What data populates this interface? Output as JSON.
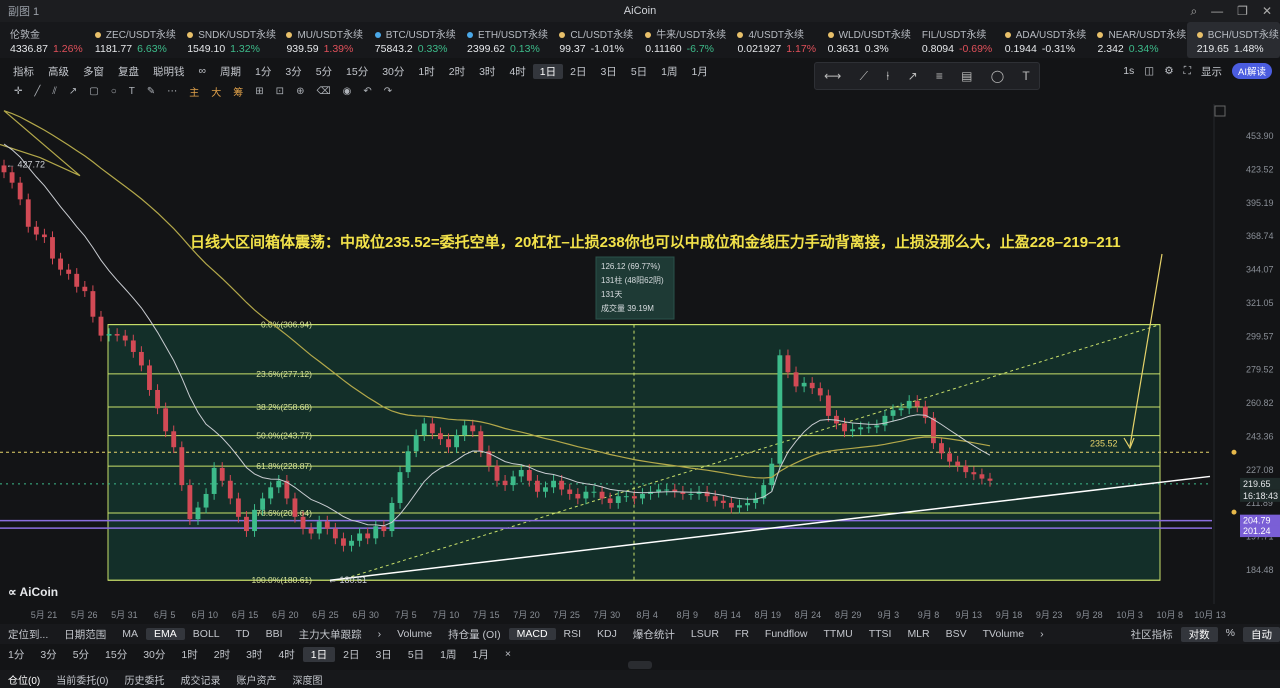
{
  "window": {
    "tab": "副图 1",
    "title": "AiCoin"
  },
  "tickers": [
    {
      "name": "伦敦金",
      "price": "4336.87",
      "change": "1.26%",
      "dir": "dn",
      "dot": ""
    },
    {
      "name": "ZEC/USDT永续",
      "price": "1181.77",
      "change": "6.63%",
      "dir": "up",
      "dot": "#e8c06a"
    },
    {
      "name": "SNDK/USDT永续",
      "price": "1549.10",
      "change": "1.32%",
      "dir": "up",
      "dot": "#e8c06a"
    },
    {
      "name": "MU/USDT永续",
      "price": "939.59",
      "change": "1.39%",
      "dir": "dn",
      "dot": "#e8c06a"
    },
    {
      "name": "BTC/USDT永续",
      "price": "75843.2",
      "change": "0.33%",
      "dir": "up",
      "dot": "#4aa8e8"
    },
    {
      "name": "ETH/USDT永续",
      "price": "2399.62",
      "change": "0.13%",
      "dir": "up",
      "dot": "#4aa8e8"
    },
    {
      "name": "CL/USDT永续",
      "price": "99.37",
      "change": "-1.01%",
      "dir": "wh",
      "dot": "#e8c06a"
    },
    {
      "name": "牛来/USDT永续",
      "price": "0.11160",
      "change": "-6.7%",
      "dir": "up",
      "dot": "#e8c06a"
    },
    {
      "name": "4/USDT永续",
      "price": "0.021927",
      "change": "1.17%",
      "dir": "dn",
      "dot": "#e8c06a"
    },
    {
      "name": "WLD/USDT永续",
      "price": "0.3631",
      "change": "0.3%",
      "dir": "wh",
      "dot": "#e8c06a"
    },
    {
      "name": "FIL/USDT永续",
      "price": "0.8094",
      "change": "-0.69%",
      "dir": "dn",
      "dot": ""
    },
    {
      "name": "ADA/USDT永续",
      "price": "0.1944",
      "change": "-0.31%",
      "dir": "wh",
      "dot": "#e8c06a"
    },
    {
      "name": "NEAR/USDT永续",
      "price": "2.342",
      "change": "0.34%",
      "dir": "up",
      "dot": "#e8c06a"
    },
    {
      "name": "BCH/USDT永续",
      "price": "219.65",
      "change": "1.48%",
      "dir": "wh",
      "dot": "#e8c06a",
      "active": true
    }
  ],
  "toolbar": {
    "items": [
      "指标",
      "高级",
      "多窗",
      "复盘",
      "聪明钱",
      "∞",
      "周期",
      "1分",
      "3分",
      "5分",
      "15分",
      "30分",
      "1时",
      "2时",
      "3时",
      "4时",
      "1日",
      "2日",
      "3日",
      "5日",
      "1周",
      "1月"
    ],
    "selected": "1日"
  },
  "toolbar_right": {
    "interval": "1s",
    "display": "显示",
    "ai": "AI解读"
  },
  "draw_tools": [
    "主",
    "大",
    "筹"
  ],
  "annotation": "日线大区间箱体震荡：中成位235.52=委托空单，20杠杠–止损238你也可以中成位和金线压力手动背离接，止损没那么大，止盈228–219–211",
  "tooltip": {
    "line1": "126.12 (69.77%)",
    "line2": "131柱 (48阳62阴)",
    "line3": "131天",
    "line4": "成交量 39.19M"
  },
  "high_label": "427.72",
  "low_label": "180.61",
  "level_label": "235.52",
  "price_tag": {
    "price": "219.65",
    "time": "16:18:43"
  },
  "purple_tags": [
    "204.79",
    "201.24"
  ],
  "logo": "AiCoin",
  "chart_data": {
    "type": "candlestick",
    "y_ticks": [
      453.9,
      423.52,
      395.19,
      368.74,
      344.07,
      321.05,
      299.57,
      279.52,
      260.82,
      243.36,
      227.08,
      211.89,
      197.71,
      184.48
    ],
    "x_ticks": [
      "5月 21",
      "5月 26",
      "5月 31",
      "6月 5",
      "6月 10",
      "6月 15",
      "6月 20",
      "6月 25",
      "6月 30",
      "7月 5",
      "7月 10",
      "7月 15",
      "7月 20",
      "7月 25",
      "7月 30",
      "8月 4",
      "8月 9",
      "8月 14",
      "8月 19",
      "8月 24",
      "8月 29",
      "9月 3",
      "9月 8",
      "9月 13",
      "9月 18",
      "9月 23",
      "9月 28",
      "10月 3",
      "10月 8",
      "10月 13"
    ],
    "fib_levels": [
      {
        "label": "0.0%(306.94)",
        "price": 306.94
      },
      {
        "label": "23.6%(277.12)",
        "price": 277.12
      },
      {
        "label": "38.2%(258.68)",
        "price": 258.68
      },
      {
        "label": "50.0%(243.77)",
        "price": 243.77
      },
      {
        "label": "61.8%(228.87)",
        "price": 228.87
      },
      {
        "label": "78.6%(207.64)",
        "price": 207.64
      },
      {
        "label": "100.0%(180.61)",
        "price": 180.61
      }
    ],
    "candles_close": [
      421,
      412,
      398,
      376,
      370,
      368,
      352,
      344,
      341,
      332,
      329,
      312,
      300,
      301,
      300,
      297,
      290,
      282,
      268,
      258,
      246,
      238,
      220,
      205,
      210,
      216,
      228,
      222,
      214,
      206,
      200,
      209,
      214,
      219,
      222,
      214,
      206,
      201,
      199,
      204,
      201,
      197,
      194,
      196,
      199,
      197,
      202,
      200,
      212,
      226,
      236,
      244,
      250,
      245,
      242,
      238,
      244,
      249,
      246,
      236,
      229,
      222,
      220,
      224,
      227,
      222,
      217,
      219,
      222,
      218,
      216,
      214,
      217,
      217,
      214,
      212,
      215,
      215,
      214,
      216,
      217,
      218,
      218,
      217,
      216,
      216,
      217,
      215,
      213,
      212,
      210,
      211,
      212,
      214,
      220,
      230,
      288,
      278,
      270,
      272,
      269,
      265,
      254,
      250,
      246,
      247,
      248,
      248,
      249,
      254,
      257,
      258,
      262,
      259,
      253,
      240,
      235,
      231,
      229,
      226,
      225,
      223,
      222
    ],
    "current_price": 219.65
  },
  "bottom_indicators": {
    "left": [
      "定位到...",
      "日期范围",
      "MA",
      "EMA",
      "BOLL",
      "TD",
      "BBI",
      "主力大单跟踪"
    ],
    "mid": [
      "Volume",
      "持仓量 (OI)",
      "MACD",
      "RSI",
      "KDJ",
      "爆仓统计",
      "LSUR",
      "FR",
      "Fundflow",
      "TTMU",
      "TTSI",
      "MLR",
      "BSV",
      "TVolume"
    ],
    "right": [
      "社区指标",
      "对数",
      "%",
      "自动"
    ],
    "sel_left": "EMA",
    "sel_mid": "MACD"
  },
  "bottom_periods": {
    "items": [
      "1分",
      "3分",
      "5分",
      "15分",
      "30分",
      "1时",
      "2时",
      "3时",
      "4时",
      "1日",
      "2日",
      "3日",
      "5日",
      "1周",
      "1月"
    ],
    "selected": "1日"
  },
  "bottom_tabs": [
    "仓位(0)",
    "当前委托(0)",
    "历史委托",
    "成交记录",
    "账户资产",
    "深度图"
  ]
}
